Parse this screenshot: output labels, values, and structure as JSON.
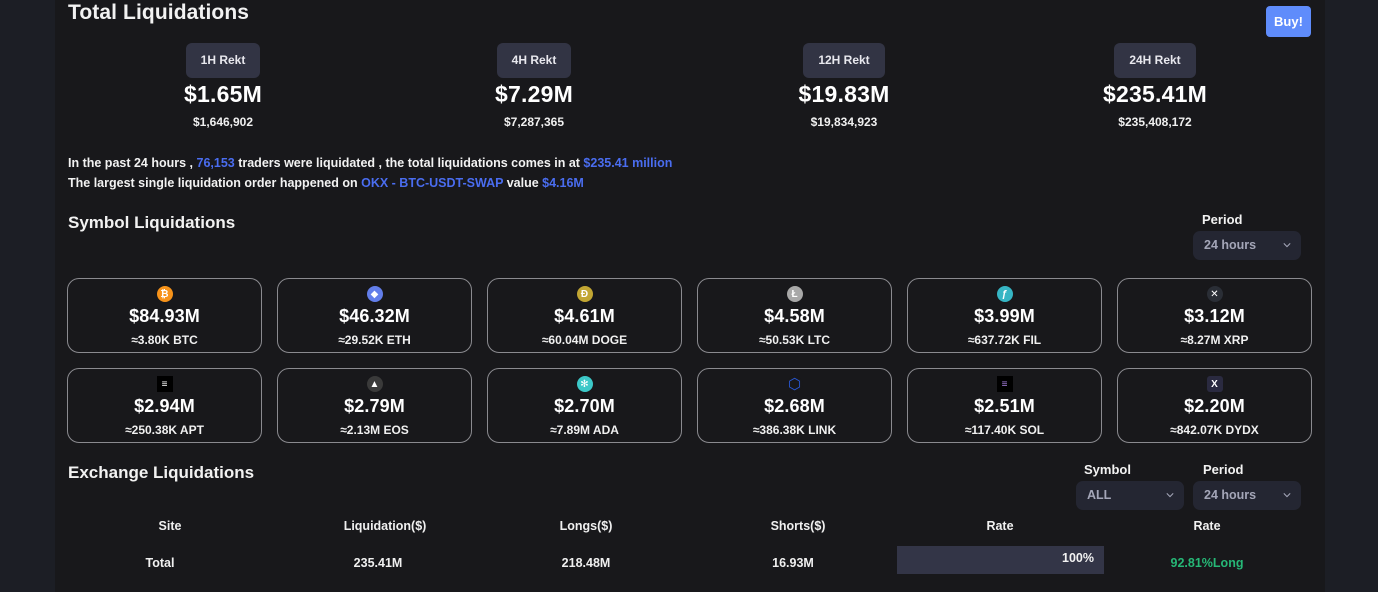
{
  "header": {
    "title": "Total Liquidations",
    "buy_label": "Buy!"
  },
  "rekt": [
    {
      "label": "1H Rekt",
      "short": "$1.65M",
      "full": "$1,646,902"
    },
    {
      "label": "4H Rekt",
      "short": "$7.29M",
      "full": "$7,287,365"
    },
    {
      "label": "12H Rekt",
      "short": "$19.83M",
      "full": "$19,834,923"
    },
    {
      "label": "24H Rekt",
      "short": "$235.41M",
      "full": "$235,408,172"
    }
  ],
  "summary": {
    "line1_a": "In the past 24 hours , ",
    "traders": "76,153",
    "line1_b": " traders were liquidated , the total liquidations comes in at ",
    "total": "$235.41 million",
    "line2_a": "The largest single liquidation order happened on ",
    "exchange_pair": "OKX - BTC-USDT-SWAP",
    "line2_b": " value ",
    "largest_value": "$4.16M"
  },
  "symbol_section": {
    "title": "Symbol Liquidations",
    "period_label": "Period",
    "period_value": "24 hours"
  },
  "symbols": [
    {
      "symbol": "BTC",
      "icon": "bitcoin-icon",
      "glyph": "₿",
      "color": "#f7931a",
      "amount": "$84.93M",
      "qty": "≈3.80K BTC"
    },
    {
      "symbol": "ETH",
      "icon": "ethereum-icon",
      "glyph": "◆",
      "color": "#627eea",
      "amount": "$46.32M",
      "qty": "≈29.52K ETH"
    },
    {
      "symbol": "DOGE",
      "icon": "dogecoin-icon",
      "glyph": "Đ",
      "color": "#c2a633",
      "amount": "$4.61M",
      "qty": "≈60.04M DOGE"
    },
    {
      "symbol": "LTC",
      "icon": "litecoin-icon",
      "glyph": "Ł",
      "color": "#a8a8a8",
      "amount": "$4.58M",
      "qty": "≈50.53K LTC"
    },
    {
      "symbol": "FIL",
      "icon": "filecoin-icon",
      "glyph": "ƒ",
      "color": "#36b5c4",
      "amount": "$3.99M",
      "qty": "≈637.72K FIL"
    },
    {
      "symbol": "XRP",
      "icon": "xrp-icon",
      "glyph": "✕",
      "color": "#2a2e36",
      "amount": "$3.12M",
      "qty": "≈8.27M XRP"
    },
    {
      "symbol": "APT",
      "icon": "aptos-icon",
      "glyph": "≡",
      "color": "#000000",
      "amount": "$2.94M",
      "qty": "≈250.38K APT"
    },
    {
      "symbol": "EOS",
      "icon": "eos-icon",
      "glyph": "▲",
      "color": "#3a3a3a",
      "amount": "$2.79M",
      "qty": "≈2.13M EOS"
    },
    {
      "symbol": "ADA",
      "icon": "cardano-icon",
      "glyph": "✻",
      "color": "#3cc8c8",
      "amount": "$2.70M",
      "qty": "≈7.89M ADA"
    },
    {
      "symbol": "LINK",
      "icon": "chainlink-icon",
      "glyph": "⬡",
      "color": "#18181b",
      "amount": "$2.68M",
      "qty": "≈386.38K LINK"
    },
    {
      "symbol": "SOL",
      "icon": "solana-icon",
      "glyph": "≡",
      "color": "#000000",
      "amount": "$2.51M",
      "qty": "≈117.40K SOL"
    },
    {
      "symbol": "DYDX",
      "icon": "dydx-icon",
      "glyph": "X",
      "color": "#2a2a40",
      "amount": "$2.20M",
      "qty": "≈842.07K DYDX"
    }
  ],
  "exchange_section": {
    "title": "Exchange Liquidations",
    "symbol_label": "Symbol",
    "symbol_value": "ALL",
    "period_label": "Period",
    "period_value": "24 hours"
  },
  "table": {
    "headers": [
      "Site",
      "Liquidation($)",
      "Longs($)",
      "Shorts($)",
      "Rate",
      "Rate"
    ],
    "rows": [
      {
        "site": "Total",
        "liquidation": "235.41M",
        "longs": "218.48M",
        "shorts": "16.93M",
        "rate_pct": "100%",
        "long_rate": "92.81%Long"
      }
    ]
  },
  "colors": {
    "accent_blue": "#4a6df0",
    "buy_button": "#5f8cfb",
    "long_green": "#26b877"
  }
}
